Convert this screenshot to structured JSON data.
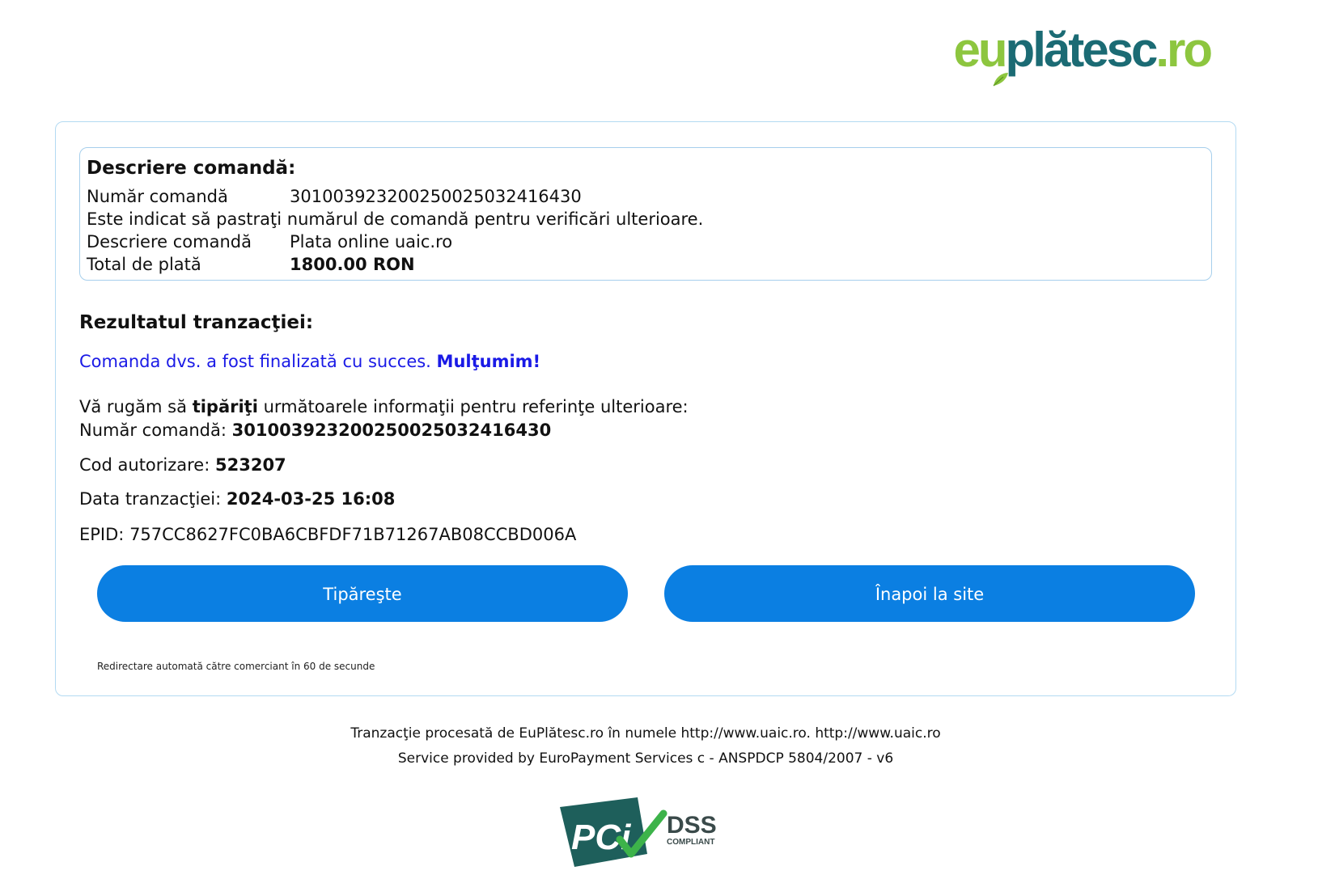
{
  "brand": {
    "logo_eu": "eu",
    "logo_platesc": "plătesc",
    "logo_ro": ".ro",
    "color_green": "#8dc63f",
    "color_teal": "#1b6b74"
  },
  "order": {
    "heading": "Descriere comandă:",
    "number_label": "Număr comandă",
    "number_value": "301003923200250025032416430",
    "note": "Este indicat să pastraţi numărul de comandă pentru verificări ulterioare.",
    "description_label": "Descriere comandă",
    "description_value": "Plata online uaic.ro",
    "total_label": "Total de plată",
    "total_value": "1800.00 RON"
  },
  "result": {
    "heading": "Rezultatul tranzacţiei:",
    "success_message": "Comanda dvs. a fost finalizată cu succes.",
    "thanks": "Mulţumim!",
    "success_color": "#1a1ae6",
    "print_prefix": "Vă rugăm să",
    "print_bold": "tipăriţi",
    "print_suffix": "următoarele informaţii pentru referinţe ulterioare:",
    "order_number_label": "Număr comandă:",
    "order_number_value": "301003923200250025032416430",
    "auth_label": "Cod autorizare:",
    "auth_value": "523207",
    "date_label": "Data tranzacţiei:",
    "date_value": "2024-03-25 16:08",
    "epid_label": "EPID:",
    "epid_value": "757CC8627FC0BA6CBFDF71B71267AB08CCBD006A"
  },
  "buttons": {
    "print_label": "Tipăreşte",
    "back_label": "Înapoi la site",
    "color": "#0b7fe2"
  },
  "redirect_text": "Redirectare automată către comerciant în 60 de secunde",
  "footer": {
    "line1": "Tranzacţie procesată de EuPlătesc.ro în numele http://www.uaic.ro. http://www.uaic.ro",
    "line2": "Service provided by EuroPayment Services c - ANSPDCP 5804/2007 - v6"
  },
  "pci_badge": {
    "pci": "PCi",
    "dss": "DSS",
    "compliant": "COMPLIANT"
  }
}
